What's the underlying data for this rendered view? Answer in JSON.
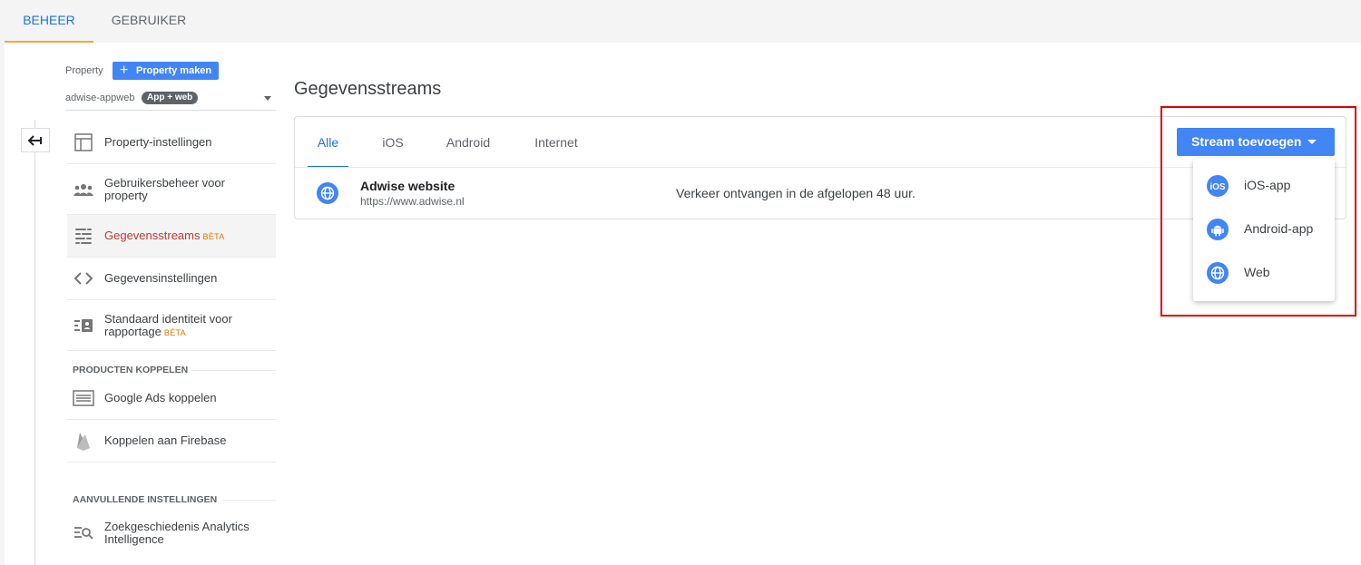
{
  "top_tabs": [
    {
      "label": "BEHEER",
      "active": true
    },
    {
      "label": "GEBRUIKER",
      "active": false
    }
  ],
  "property": {
    "label": "Property",
    "create_button": "Property maken",
    "selected_name": "adwise-appweb",
    "selected_badge": "App + web"
  },
  "sidebar": {
    "items": [
      {
        "label": "Property-instellingen",
        "icon": "layout-icon"
      },
      {
        "label": "Gebruikersbeheer voor property",
        "icon": "people-icon"
      },
      {
        "label": "Gegevensstreams",
        "badge": "BÈTA",
        "icon": "streams-icon",
        "active": true
      },
      {
        "label": "Gegevensinstellingen",
        "icon": "code-icon"
      },
      {
        "label": "Standaard identiteit voor rapportage",
        "badge": "BÈTA",
        "icon": "identity-icon"
      }
    ],
    "section_products": "PRODUCTEN KOPPELEN",
    "products": [
      {
        "label": "Google Ads koppelen",
        "icon": "google-ads-icon"
      },
      {
        "label": "Koppelen aan Firebase",
        "icon": "firebase-icon"
      }
    ],
    "section_additional": "AANVULLENDE INSTELLINGEN",
    "additional": [
      {
        "label": "Zoekgeschiedenis Analytics Intelligence",
        "icon": "search-history-icon"
      }
    ]
  },
  "main": {
    "title": "Gegevensstreams",
    "tabs": [
      {
        "label": "Alle",
        "active": true
      },
      {
        "label": "iOS"
      },
      {
        "label": "Android"
      },
      {
        "label": "Internet"
      }
    ],
    "add_stream_button": "Stream toevoegen",
    "streams": [
      {
        "name": "Adwise website",
        "url": "https://www.adwise.nl",
        "status": "Verkeer ontvangen in de afgelopen 48 uur.",
        "icon": "globe-icon"
      }
    ],
    "dropdown": [
      {
        "label": "iOS-app",
        "icon": "ios-icon",
        "icon_text": "iOS"
      },
      {
        "label": "Android-app",
        "icon": "android-icon"
      },
      {
        "label": "Web",
        "icon": "globe-icon"
      }
    ]
  },
  "colors": {
    "accent": "#1a73e8",
    "button": "#4285f4",
    "active_nav_text": "#c0392b",
    "beta": "#e37400",
    "highlight": "#e00000"
  }
}
